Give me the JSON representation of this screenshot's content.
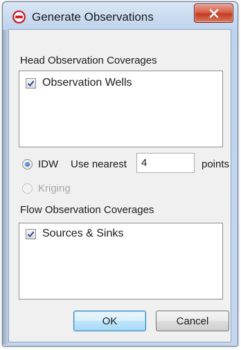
{
  "window": {
    "title": "Generate Observations",
    "app_icon": "no-entry-icon",
    "close_icon": "close-x-icon"
  },
  "head_group": {
    "label": "Head Observation Coverages",
    "items": [
      {
        "label": "Observation Wells",
        "checked": true
      }
    ]
  },
  "interpolation": {
    "idw": {
      "label": "IDW",
      "selected": true
    },
    "use_nearest_label": "Use nearest",
    "nearest_value": "4",
    "points_label": "points",
    "kriging": {
      "label": "Kriging",
      "selected": false,
      "enabled": false
    }
  },
  "flow_group": {
    "label": "Flow Observation Coverages",
    "items": [
      {
        "label": "Sources & Sinks",
        "checked": true
      }
    ]
  },
  "buttons": {
    "ok": "OK",
    "cancel": "Cancel"
  },
  "colors": {
    "frame": "#c4d7ee",
    "client": "#f0f0f0",
    "close_button": "#c23b22",
    "radio_selected": "#1b4f9c",
    "default_button_border": "#3c7fb1"
  }
}
